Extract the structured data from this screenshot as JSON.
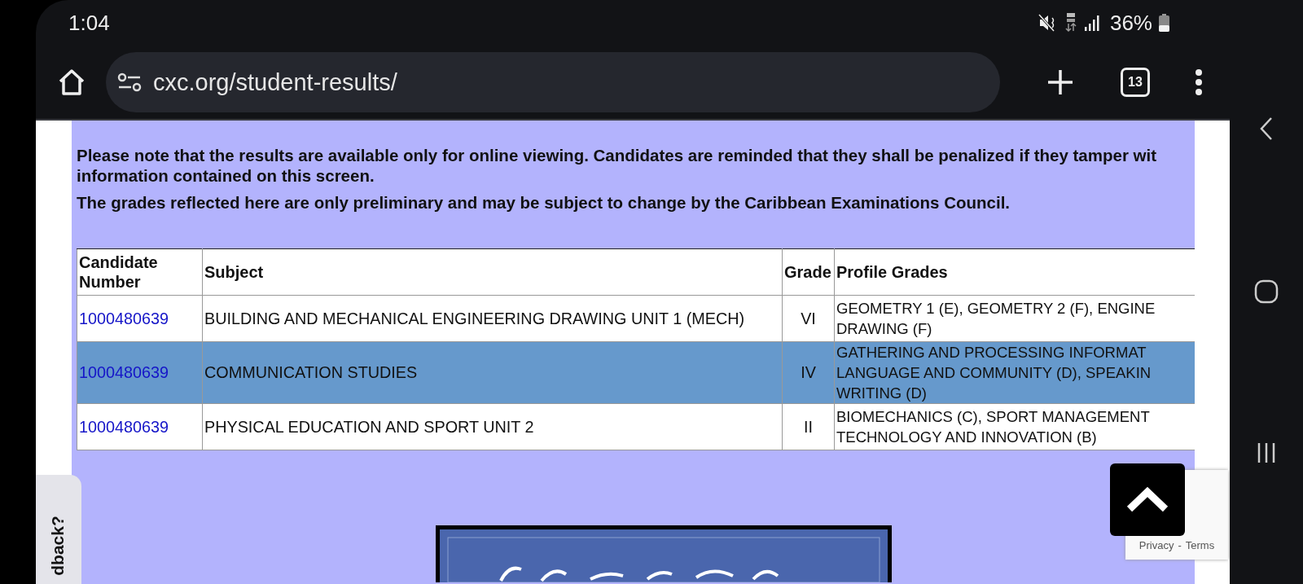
{
  "status_bar": {
    "time": "1:04",
    "battery": "36%"
  },
  "browser": {
    "url": "cxc.org/student-results/",
    "tab_count": "13"
  },
  "notice": {
    "lines": [
      "Please note that the results are available only for online viewing. Candidates are reminded that they shall be penalized if they tamper wit",
      "information contained on this screen."
    ],
    "note": "The grades reflected here are only preliminary and may be subject to change by the Caribbean Examinations Council."
  },
  "table": {
    "columns": [
      "Candidate Number",
      "Subject",
      "Grade",
      "Profile Grades"
    ],
    "rows": [
      {
        "candidate_number": "1000480639",
        "subject": "BUILDING AND MECHANICAL ENGINEERING DRAWING UNIT 1 (MECH)",
        "grade": "VI",
        "profile_grades": [
          "GEOMETRY 1 (E), GEOMETRY 2 (F), ENGINE",
          "DRAWING (F)"
        ],
        "selected": false
      },
      {
        "candidate_number": "1000480639",
        "subject": "COMMUNICATION STUDIES",
        "grade": "IV",
        "profile_grades": [
          "GATHERING AND PROCESSING INFORMAT",
          "LANGUAGE AND COMMUNITY (D), SPEAKIN",
          "WRITING (D)"
        ],
        "selected": true
      },
      {
        "candidate_number": "1000480639",
        "subject": "PHYSICAL EDUCATION AND SPORT UNIT 2",
        "grade": "II",
        "profile_grades": [
          "BIOMECHANICS (C), SPORT MANAGEMENT",
          "TECHNOLOGY AND INNOVATION (B)"
        ],
        "selected": false
      }
    ]
  },
  "feedback_tab": "dback?",
  "recaptcha": {
    "privacy": "Privacy",
    "separator": "-",
    "terms": "Terms"
  }
}
